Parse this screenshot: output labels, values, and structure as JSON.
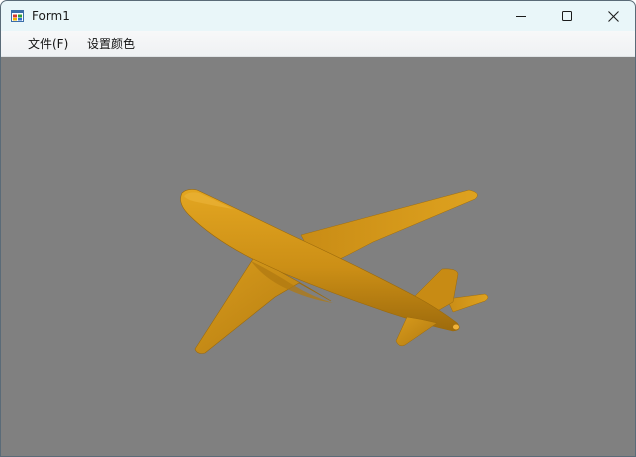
{
  "window": {
    "title": "Form1",
    "controls": [
      "minimize-icon",
      "maximize-icon",
      "close-icon"
    ]
  },
  "menu": {
    "items": [
      {
        "label": "文件(F)"
      },
      {
        "label": "设置颜色"
      }
    ]
  },
  "viewport": {
    "background_color": "#808080",
    "model": "airplane",
    "model_color": "#d4961a"
  }
}
